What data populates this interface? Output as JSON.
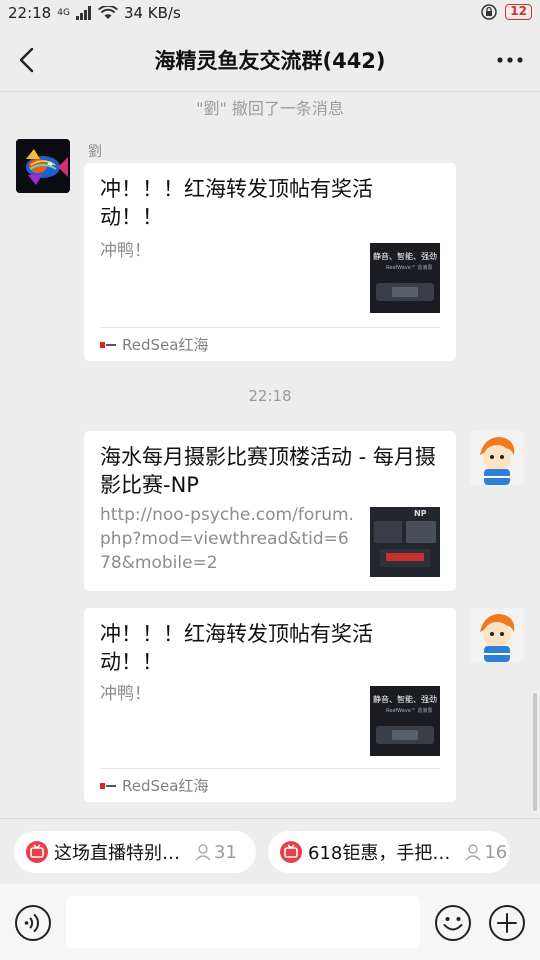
{
  "status_bar": {
    "time": "22:18",
    "network": "4G",
    "speed": "34 KB/s",
    "battery": "12"
  },
  "header": {
    "title": "海精灵鱼友交流群(442)"
  },
  "chat": {
    "recall_notice": "\"劉\" 撤回了一条消息",
    "time_divider": "22:18",
    "messages": [
      {
        "sender": "劉",
        "title": "冲！！！红海转发顶帖有奖活动！！",
        "desc": "冲鸭！",
        "source": "RedSea红海",
        "thumb_caption": "静音、智能、强劲",
        "thumb_sub": "ReefWave™ 造浪泵"
      },
      {
        "title": "海水每月摄影比赛顶楼活动 - 每月摄影比赛-NP",
        "desc": "http://noo-psyche.com/forum.php?mod=viewthread&tid=678&mobile=2",
        "thumb_caption": "NP"
      },
      {
        "title": "冲！！！红海转发顶帖有奖活动！！",
        "desc": "冲鸭！",
        "source": "RedSea红海",
        "thumb_caption": "静音、智能、强劲",
        "thumb_sub": "ReefWave™ 造浪泵"
      }
    ]
  },
  "quick_bar": {
    "items": [
      {
        "label": "这场直播特别…",
        "count": "31"
      },
      {
        "label": "618钜惠，手把…",
        "count": "16"
      }
    ]
  },
  "input_bar": {
    "placeholder": ""
  },
  "colors": {
    "background": "#ededed",
    "bubble": "#ffffff",
    "live_badge": "#e8404a",
    "muted_text": "#8d8d8d"
  },
  "icons": {
    "back": "back-arrow-icon",
    "more": "more-dots-icon",
    "voice": "voice-icon",
    "emoji": "emoji-icon",
    "plus": "plus-icon",
    "live": "live-badge-icon",
    "person": "person-icon"
  }
}
